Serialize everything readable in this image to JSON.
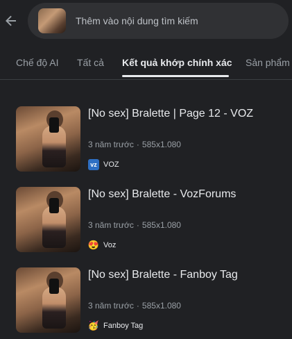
{
  "search": {
    "placeholder": "Thêm vào nội dung tìm kiếm"
  },
  "tabs": [
    {
      "label": "Chế độ AI"
    },
    {
      "label": "Tất cả"
    },
    {
      "label": "Kết quả khớp chính xác"
    },
    {
      "label": "Sản phẩm"
    }
  ],
  "results": [
    {
      "title": "[No sex] Bralette | Page 12 - VOZ",
      "time": "3 năm trước",
      "size": "585x1.080",
      "source": "VOZ",
      "favicon": "voz-logo"
    },
    {
      "title": "[No sex] Bralette - VozForums",
      "time": "3 năm trước",
      "size": "585x1.080",
      "source": "Voz",
      "favicon": "smiling-face-emoji"
    },
    {
      "title": "[No sex] Bralette - Fanboy Tag",
      "time": "3 năm trước",
      "size": "585x1.080",
      "source": "Fanboy Tag",
      "favicon": "party-face-emoji"
    }
  ]
}
